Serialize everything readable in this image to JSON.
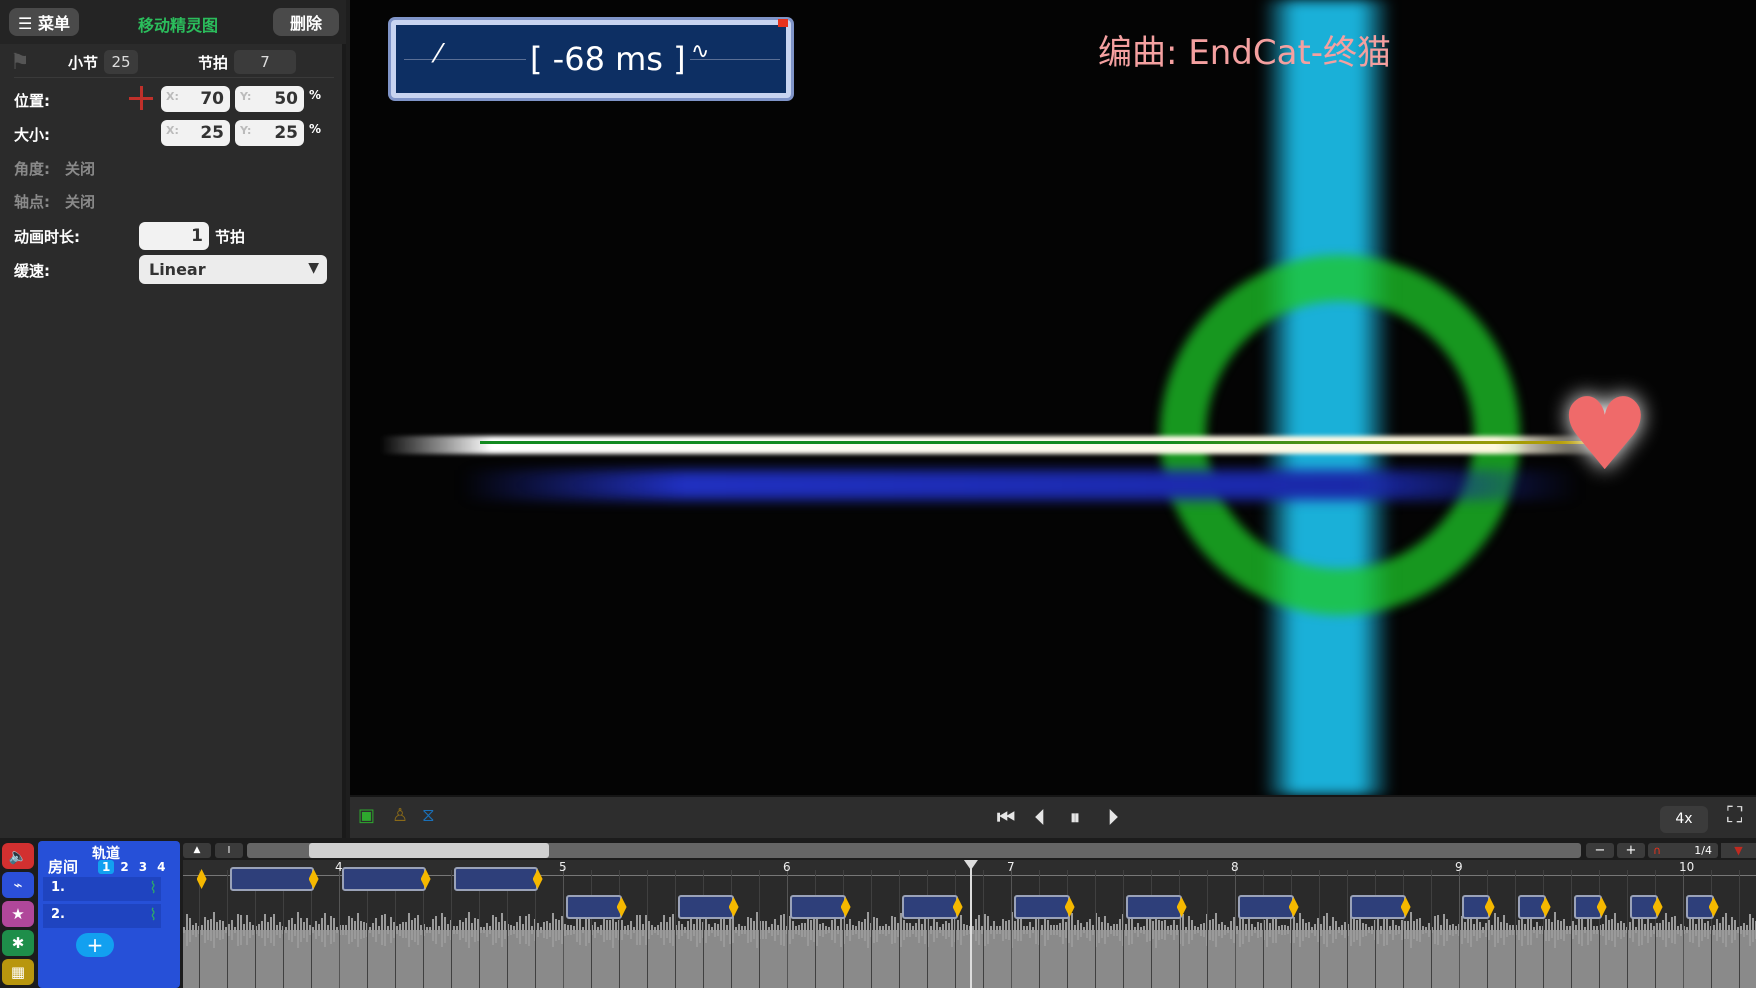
{
  "header": {
    "menu_label": "☰ 菜单",
    "title": "移动精灵图",
    "delete_label": "删除"
  },
  "inspector": {
    "bar_label": "小节",
    "bar_value": "25",
    "beat_label": "节拍",
    "beat_value": "7",
    "position_label": "位置:",
    "position_x": "70",
    "position_y": "50",
    "size_label": "大小:",
    "size_x": "25",
    "size_y": "25",
    "x_placeholder": "X:",
    "y_placeholder": "Y:",
    "percent": "%",
    "angle_label": "角度:",
    "angle_value": "关闭",
    "pivot_label": "轴点:",
    "pivot_value": "关闭",
    "duration_label": "动画时长:",
    "duration_value": "1",
    "duration_unit": "节拍",
    "ease_label": "缓速:",
    "ease_value": "Linear"
  },
  "game": {
    "offset_text": "[ -68 ms ]",
    "credit": "编曲: EndCat-终猫",
    "credit_color": "#f4a0a0",
    "beam_color": "#1ab0d8"
  },
  "transport": {
    "zoom": "4x",
    "icons": [
      "robot-icon",
      "character-icon",
      "metronome-icon",
      "skip-to-start-icon",
      "previous-icon",
      "pause-icon",
      "next-icon",
      "fullscreen-icon"
    ]
  },
  "timeline": {
    "tracks_label": "轨道",
    "rooms_label": "房间",
    "rooms": [
      "1",
      "2",
      "3",
      "4"
    ],
    "active_room": "1",
    "rows": [
      "1.",
      "2."
    ],
    "add_label": "+",
    "bar_numbers": [
      "4",
      "5",
      "6",
      "7",
      "8",
      "9",
      "10"
    ],
    "snap": "1/4",
    "zoom_out": "−",
    "zoom_in": "+",
    "tab_colors": [
      "#d23030",
      "#2b4fd8",
      "#b0479a",
      "#1e8e4a",
      "#b8960e"
    ]
  }
}
